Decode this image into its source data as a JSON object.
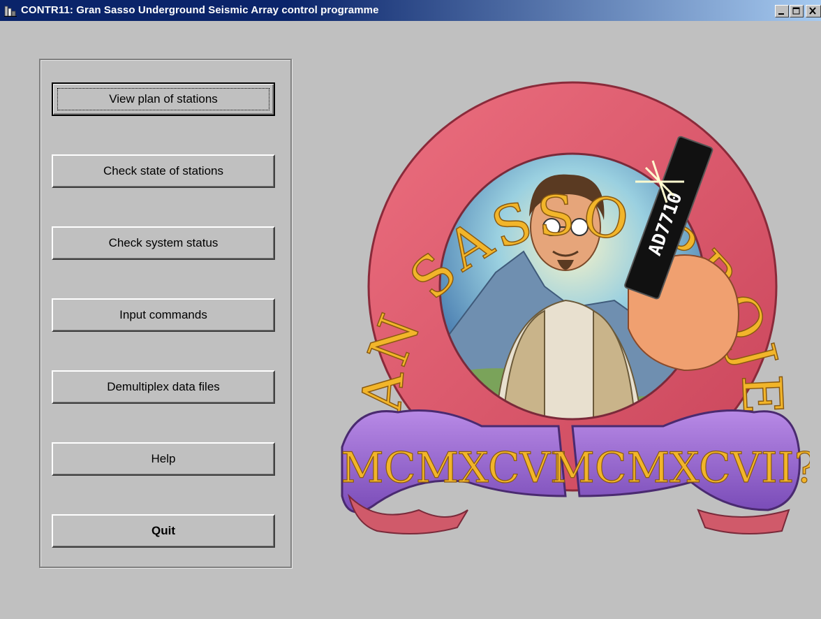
{
  "window": {
    "title": "CONTR11: Gran Sasso Underground Seismic Array control programme",
    "controls": [
      "minimize",
      "maximize",
      "close"
    ]
  },
  "menu": {
    "buttons": [
      {
        "label": "View plan of stations"
      },
      {
        "label": "Check state of stations"
      },
      {
        "label": "Check system status"
      },
      {
        "label": "Input commands"
      },
      {
        "label": "Demultiplex data files"
      },
      {
        "label": "Help"
      },
      {
        "label": "Quit"
      }
    ]
  },
  "logo": {
    "arc_text": "GRAN SASSO PROJECT",
    "chip_label": "AD7710",
    "banner_text_left": "MCMXCVI",
    "banner_text_right": "MCMXCVII?"
  },
  "colors": {
    "face": "#c0c0c0",
    "titlebar_start": "#0a246a",
    "titlebar_end": "#a6caf0",
    "logo_ring": "#e05a6a",
    "logo_letters": "#f2b52a",
    "banner": "#9a6bd0"
  }
}
